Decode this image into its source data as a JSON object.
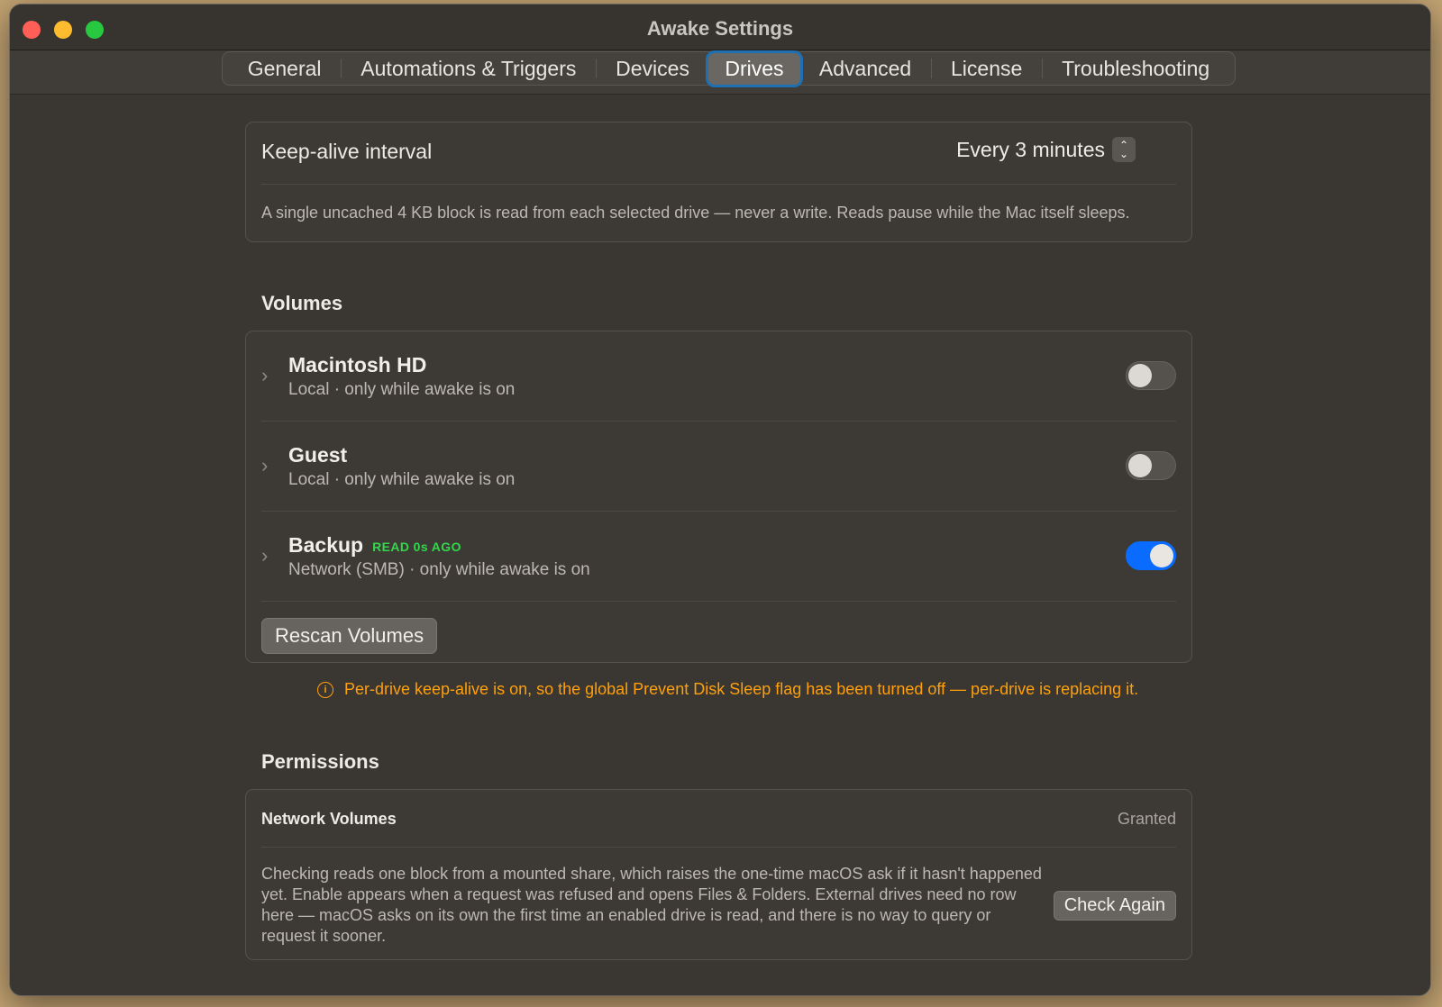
{
  "window": {
    "title": "Awake Settings"
  },
  "tabs": [
    {
      "label": "General"
    },
    {
      "label": "Automations & Triggers"
    },
    {
      "label": "Devices"
    },
    {
      "label": "Drives",
      "active": true
    },
    {
      "label": "Advanced"
    },
    {
      "label": "License"
    },
    {
      "label": "Troubleshooting"
    }
  ],
  "keepalive": {
    "label": "Keep-alive interval",
    "value": "Every 3 minutes",
    "description": "A single uncached 4 KB block is read from each selected drive — never a write. Reads pause while the Mac itself sleeps."
  },
  "volumes": {
    "heading": "Volumes",
    "items": [
      {
        "name": "Macintosh HD",
        "badge": "",
        "sub": "Local · only while awake is on",
        "enabled": false
      },
      {
        "name": "Guest",
        "badge": "",
        "sub": "Local · only while awake is on",
        "enabled": false
      },
      {
        "name": "Backup",
        "badge": "READ 0s AGO",
        "sub": "Network (SMB) · only while awake is on",
        "enabled": true
      }
    ],
    "rescan_label": "Rescan Volumes"
  },
  "warning": {
    "icon": "info-circle-icon",
    "text": "Per-drive keep-alive is on, so the global Prevent Disk Sleep flag has been turned off — per-drive is replacing it."
  },
  "permissions": {
    "heading": "Permissions",
    "label": "Network Volumes",
    "status": "Granted",
    "description": "Checking reads one block from a mounted share, which raises the one-time macOS ask if it hasn't happened yet. Enable appears when a request was refused and opens Files & Folders. External drives need no row here — macOS asks on its own the first time an enabled drive is read, and there is no way to query or request it sooner.",
    "button_label": "Check Again"
  },
  "colors": {
    "accent": "#0a6cff",
    "warning": "#ff9f0a",
    "badge_green": "#32d74b"
  }
}
